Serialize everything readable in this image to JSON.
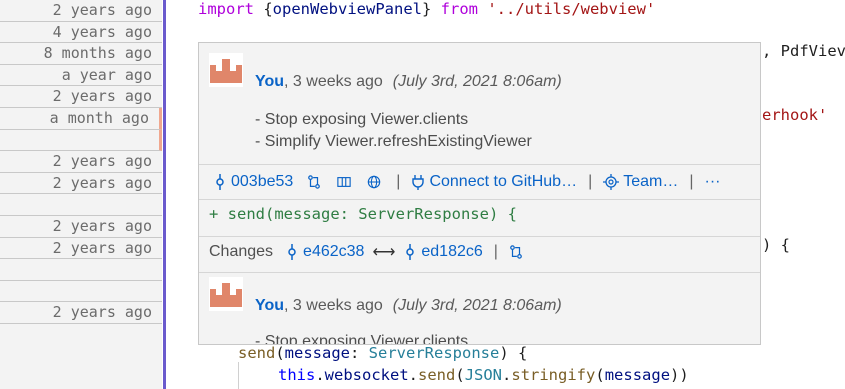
{
  "blame": [
    {
      "text": "2 years ago"
    },
    {
      "text": "4 years ago"
    },
    {
      "text": "8 months ago"
    },
    {
      "text": "a year ago"
    },
    {
      "text": "2 years ago"
    },
    {
      "text": "a month ago"
    },
    {
      "text": ""
    },
    {
      "text": "2 years ago"
    },
    {
      "text": "2 years ago"
    },
    {
      "text": ""
    },
    {
      "text": "2 years ago"
    },
    {
      "text": "2 years ago"
    },
    {
      "text": ""
    },
    {
      "text": ""
    },
    {
      "text": "2 years ago"
    }
  ],
  "code": {
    "line1": {
      "kw": "import",
      "open": " {",
      "name": "openWebviewPanel",
      "close": "} ",
      "from": "from",
      "space": " ",
      "path": "'../utils/webview'"
    },
    "line2_right": ", PdfViev",
    "line3_right": "erhook'",
    "line4_right": ") {",
    "send_line": {
      "fn": "send",
      "paren": "(",
      "param": "message",
      "colon": ": ",
      "type": "ServerResponse",
      "end": ") {"
    },
    "ws_line": {
      "this": "this",
      "dot1": ".",
      "prop": "websocket",
      "dot2": ".",
      "fn": "send",
      "p1": "(",
      "json": "JSON",
      "dot3": ".",
      "strfn": "stringify",
      "p2": "(",
      "arg": "message",
      "end": "))"
    }
  },
  "hover": {
    "author": "You",
    "relative": ", 3 weeks ago",
    "date": "(July 3rd, 2021 8:06am)",
    "messages": [
      "- Stop exposing Viewer.clients",
      "- Simplify Viewer.refreshExistingViewer"
    ],
    "sha": "003be53",
    "connect": "Connect to GitHub…",
    "team": "Team…",
    "more": "···",
    "sep": "|",
    "diff": "+ send(message: ServerResponse) {",
    "changes_label": "Changes",
    "from_sha": "e462c38",
    "arrow": "⟷",
    "to_sha": "ed182c6",
    "second_author": "You",
    "second_relative": ", 3 weeks ago",
    "second_date": "(July 3rd, 2021 8:06am)",
    "second_message": "- Stop exposing Viewer.clients"
  },
  "colors": {
    "accent": "#0a63c7",
    "gutter_rule": "#6a5acd",
    "avatar": "#e0866a",
    "diff_add": "#2f7d43"
  }
}
